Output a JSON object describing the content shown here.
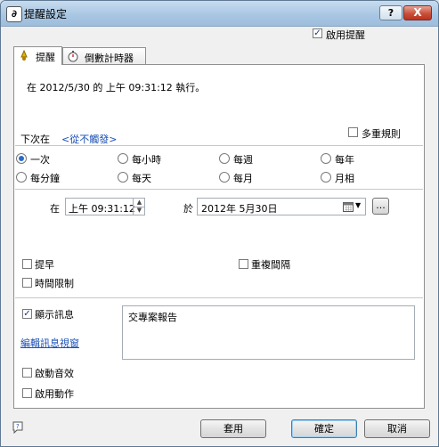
{
  "window": {
    "title": "提醒設定"
  },
  "enable_reminder": {
    "label": "啟用提醒",
    "checked": true
  },
  "tabs": [
    {
      "label": "提醒",
      "active": true
    },
    {
      "label": "倒數計時器",
      "active": false
    }
  ],
  "summary": {
    "text": "在 2012/5/30 的 上午 09:31:12 執行。"
  },
  "next_run": {
    "label": "下次在",
    "value": "<從不觸發>"
  },
  "multiple_rules": {
    "label": "多重規則",
    "checked": false
  },
  "frequency": {
    "options": [
      "一次",
      "每小時",
      "每週",
      "每年",
      "每分鐘",
      "每天",
      "每月",
      "月相"
    ],
    "selected": "一次"
  },
  "schedule": {
    "at_label": "在",
    "time_value": "上午 09:31:12",
    "on_label": "於",
    "date_value": "2012年  5月30日",
    "more_label": "..."
  },
  "options": {
    "early": {
      "label": "提早",
      "checked": false
    },
    "repeat_interval": {
      "label": "重複間隔",
      "checked": false
    },
    "time_limit": {
      "label": "時間限制",
      "checked": false
    }
  },
  "message": {
    "show_label": "顯示訊息",
    "show_checked": true,
    "edit_link": "編輯訊息視窗",
    "text": "交專案報告"
  },
  "sound": {
    "label": "啟動音效",
    "checked": false
  },
  "action": {
    "label": "啟用動作",
    "checked": false
  },
  "buttons": {
    "apply": "套用",
    "ok": "確定",
    "cancel": "取消"
  },
  "help_button": "?",
  "close_button": "X"
}
